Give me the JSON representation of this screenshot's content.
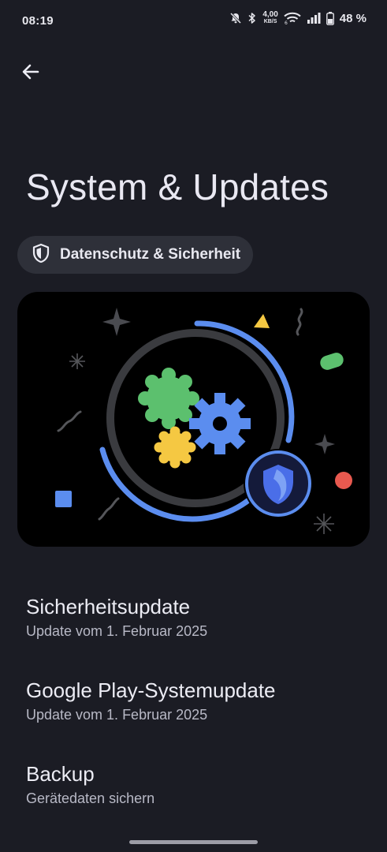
{
  "status_bar": {
    "time": "08:19",
    "net_speed_value": "4,00",
    "net_speed_unit": "KB/S",
    "battery_percent": "48 %"
  },
  "header": {
    "back_icon": "arrow-left-icon",
    "title": "System & Updates"
  },
  "chip": {
    "icon": "shield-icon",
    "label": "Datenschutz & Sicherheit"
  },
  "illustration": {
    "description_icon": "gears-shield-illustration",
    "colors": {
      "blue": "#5b8def",
      "green": "#5cc06e",
      "yellow": "#f5c842",
      "red": "#e8594f",
      "ring": "#3a3b3f"
    }
  },
  "list": [
    {
      "title": "Sicherheitsupdate",
      "subtitle": "Update vom 1. Februar 2025"
    },
    {
      "title": "Google Play-Systemupdate",
      "subtitle": "Update vom 1. Februar 2025"
    },
    {
      "title": "Backup",
      "subtitle": "Gerätedaten sichern"
    }
  ]
}
